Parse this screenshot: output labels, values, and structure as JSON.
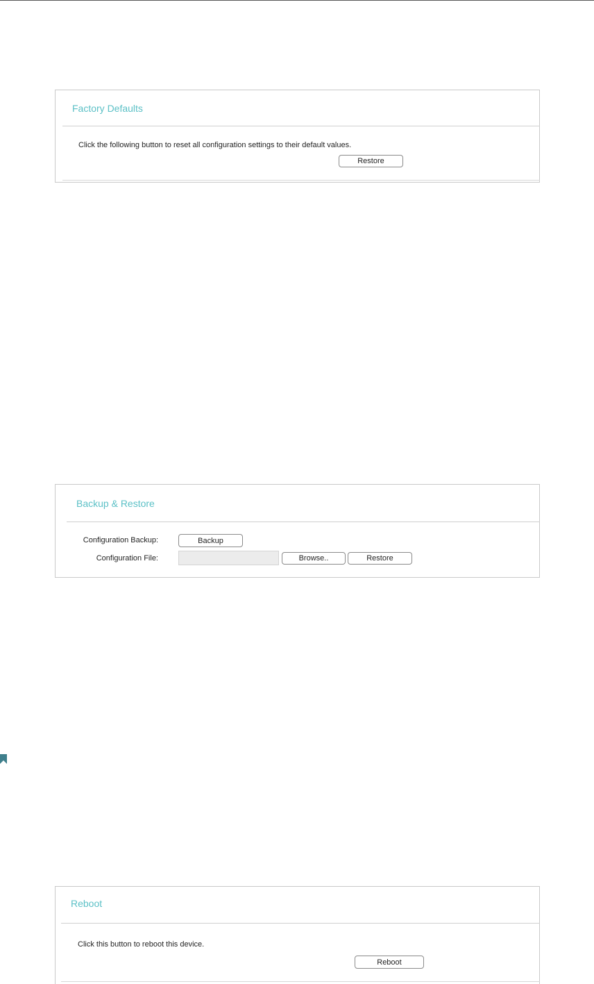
{
  "factory_defaults": {
    "title": "Factory Defaults",
    "description": "Click the following button to reset all configuration settings to their default values.",
    "restore_label": "Restore"
  },
  "backup_restore": {
    "title": "Backup & Restore",
    "backup_label_text": "Configuration Backup:",
    "backup_button": "Backup",
    "file_label_text": "Configuration File:",
    "file_value": "",
    "browse_button": "Browse..",
    "restore_button": "Restore"
  },
  "reboot": {
    "title": "Reboot",
    "description": "Click this button to reboot this device.",
    "reboot_button": "Reboot"
  },
  "icons": {
    "side_marker": "bookmark-icon",
    "side_marker_color": "#3f7f8c"
  },
  "colors": {
    "accent": "#5bc0c6",
    "panel_border": "#c9c9c9"
  }
}
